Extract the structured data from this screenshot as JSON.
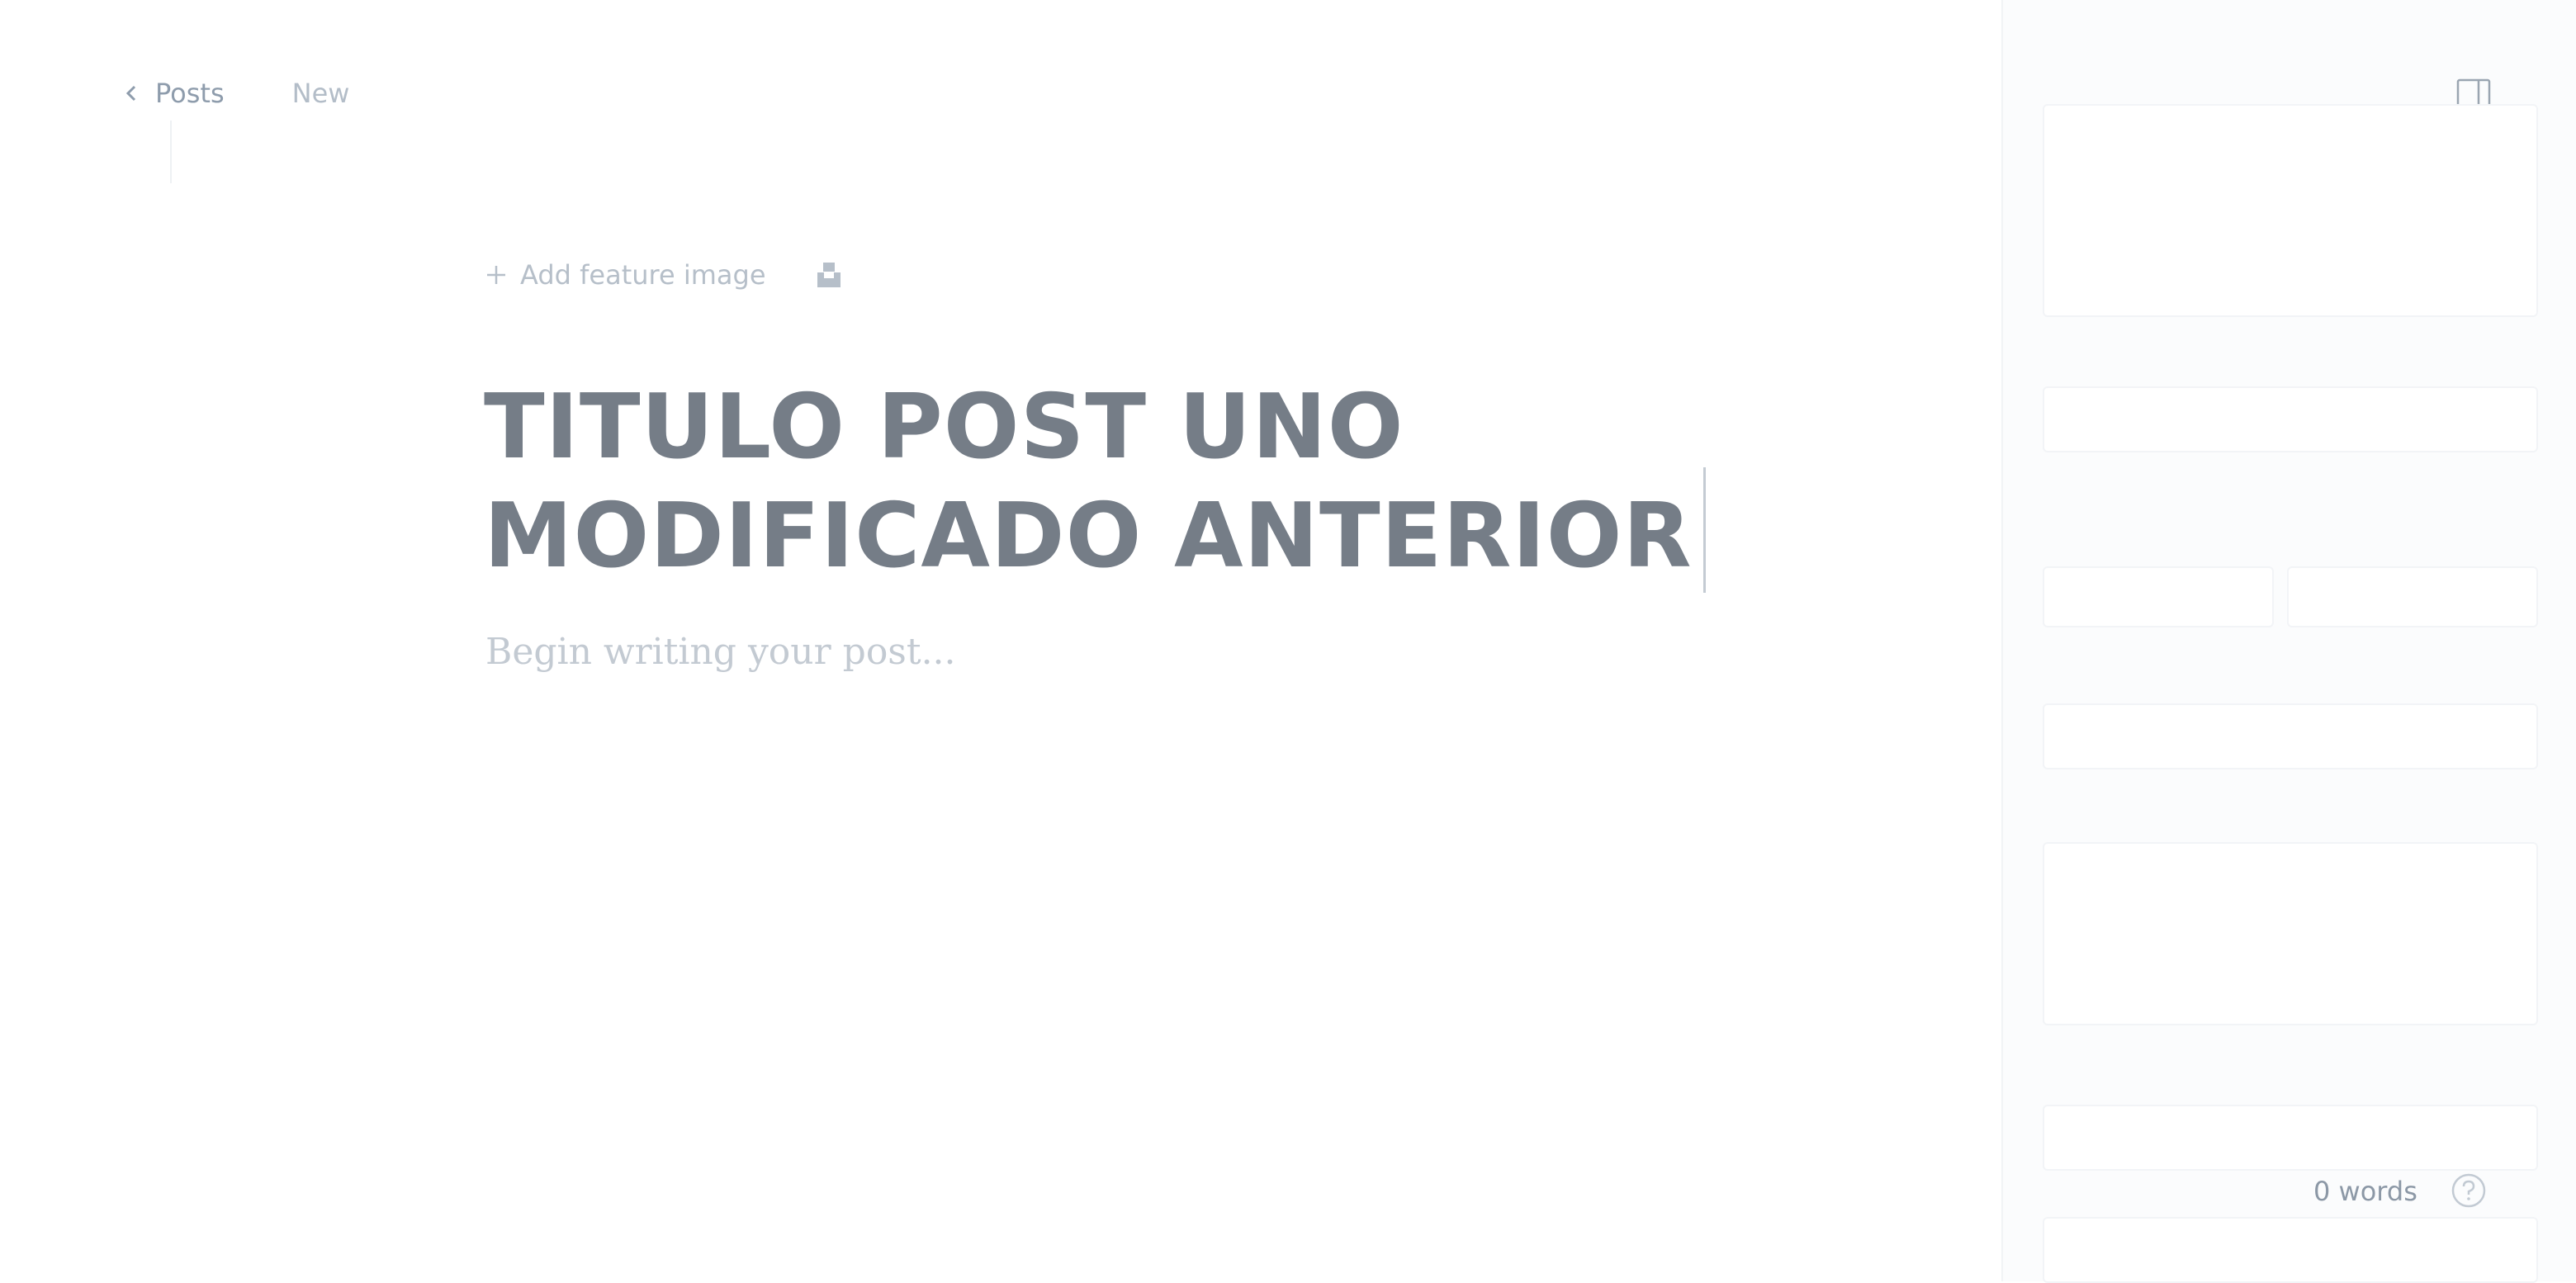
{
  "breadcrumb": {
    "back_label": "Posts",
    "status": "New"
  },
  "editor": {
    "feature_image_label": "Add feature image",
    "title": "TITULO POST UNO\nMODIFICADO ANTERIOR",
    "body_placeholder": "Begin writing your post..."
  },
  "status_bar": {
    "word_count": "0 words"
  },
  "icons": {
    "back": "chevron-left-icon",
    "add": "plus-icon",
    "unsplash": "unsplash-icon",
    "sidebar_toggle": "sidebar-toggle-icon",
    "help": "help-icon"
  },
  "colors": {
    "title": "#757d87",
    "muted_text": "#8e9cac",
    "sidebar_bg": "#fbfcfd"
  }
}
